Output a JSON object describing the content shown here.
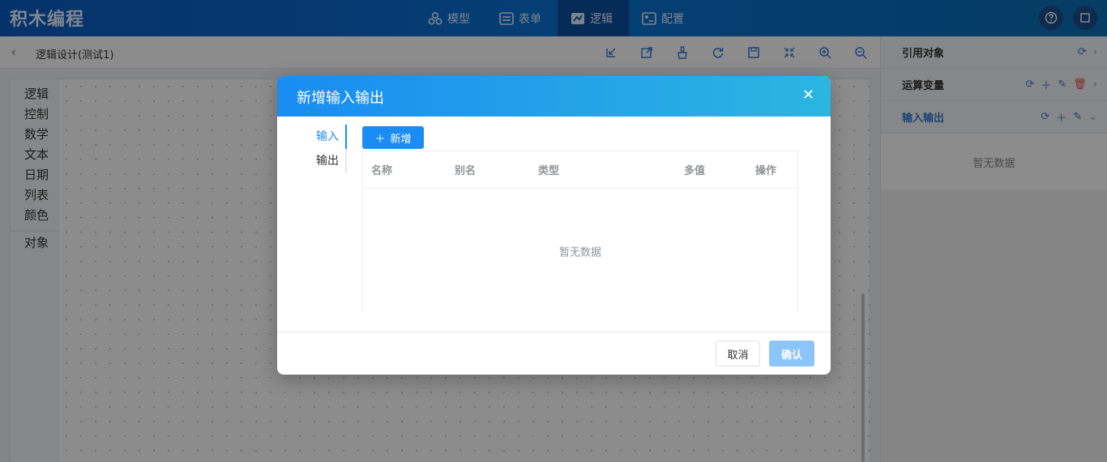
{
  "app": {
    "logo": "积木编程"
  },
  "nav": [
    {
      "label": "模型",
      "icon": "model-icon"
    },
    {
      "label": "表单",
      "icon": "form-icon"
    },
    {
      "label": "逻辑",
      "icon": "logic-icon",
      "active": true
    },
    {
      "label": "配置",
      "icon": "config-icon"
    }
  ],
  "top_right": {
    "help_icon": "help-icon",
    "window_icon": "window-icon"
  },
  "subbar": {
    "breadcrumb": "逻辑设计(测试1)",
    "tools": [
      "import-icon",
      "export-icon",
      "clean-icon",
      "refresh-icon",
      "save-icon",
      "fit-icon",
      "zoom-in-icon",
      "zoom-out-icon"
    ]
  },
  "categories": [
    "逻辑",
    "控制",
    "数学",
    "文本",
    "日期",
    "列表",
    "颜色",
    "对象"
  ],
  "right_panel": {
    "rows": [
      {
        "title": "引用对象"
      },
      {
        "title": "运算变量"
      },
      {
        "title": "输入输出",
        "active": true
      }
    ],
    "empty_text": "暂无数据"
  },
  "modal": {
    "title": "新增输入输出",
    "tabs": [
      "输入",
      "输出"
    ],
    "add_label": "新增",
    "columns": [
      "名称",
      "别名",
      "类型",
      "多值",
      "操作"
    ],
    "empty_text": "暂无数据",
    "cancel_label": "取消",
    "ok_label": "确认"
  },
  "colors": {
    "primary": "#1a8cf2",
    "topbar": "#0a6cd0",
    "danger": "#e55353",
    "ok_disabled": "#8cc5fa"
  }
}
